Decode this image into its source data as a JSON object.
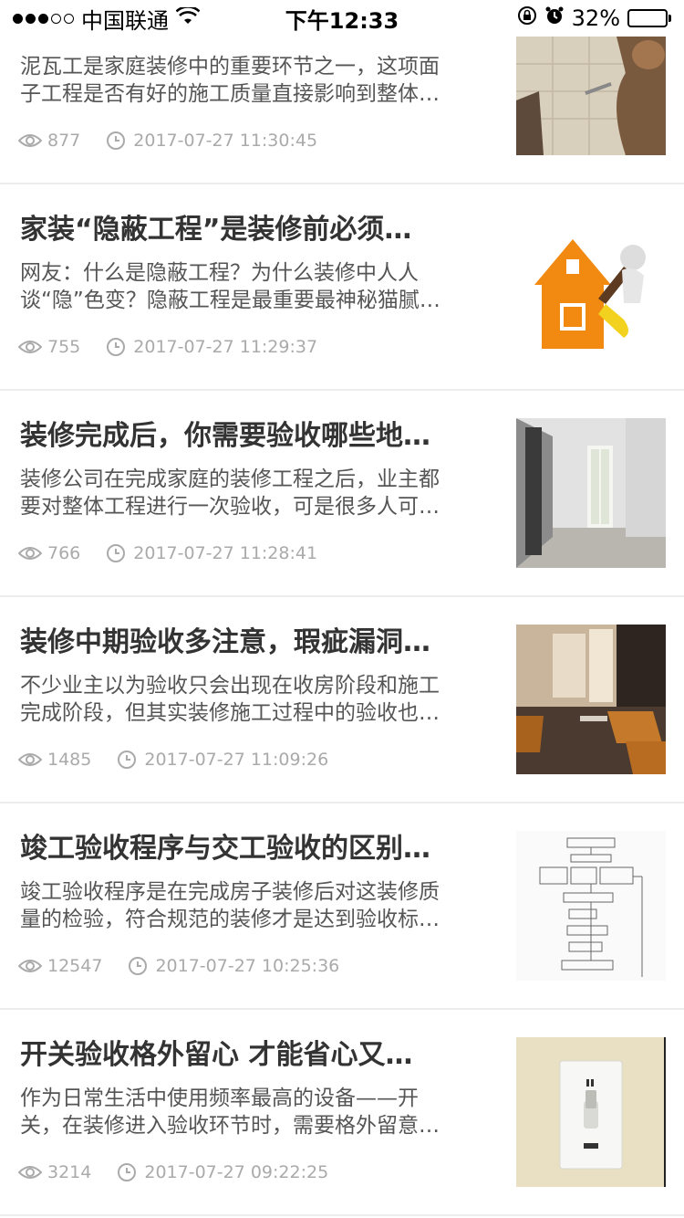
{
  "status_bar": {
    "carrier": "中国联通",
    "time": "下午12:33",
    "battery_percent": "32%",
    "battery_level": 0.32
  },
  "articles": [
    {
      "excerpt": "泥瓦工是家庭装修中的重要环节之一，这项面子工程是否有好的施工质量直接影响到整体…",
      "views": "877",
      "time": "2017-07-27 11:30:45",
      "image": "tiling-worker-photo"
    },
    {
      "title": "家装“隐蔽工程”是装修前必须…",
      "excerpt": "网友：什么是隐蔽工程？为什么装修中人人谈“隐”色变？隐蔽工程是最重要最神秘猫腻…",
      "views": "755",
      "time": "2017-07-27 11:29:37",
      "image": "orange-house-paintbrush-illustration"
    },
    {
      "title": "装修完成后，你需要验收哪些地…",
      "excerpt": "装修公司在完成家庭的装修工程之后，业主都要对整体工程进行一次验收，可是很多人可…",
      "views": "766",
      "time": "2017-07-27 11:28:41",
      "image": "empty-room-photo"
    },
    {
      "title": "装修中期验收多注意，瑕疵漏洞…",
      "excerpt": "不少业主以为验收只会出现在收房阶段和施工完成阶段，但其实装修施工过程中的验收也…",
      "views": "1485",
      "time": "2017-07-27 11:09:26",
      "image": "living-room-photo"
    },
    {
      "title": "竣工验收程序与交工验收的区别…",
      "excerpt": "竣工验收程序是在完成房子装修后对这装修质量的检验，符合规范的装修才是达到验收标…",
      "views": "12547",
      "time": "2017-07-27 10:25:36",
      "image": "flowchart-document"
    },
    {
      "title": "开关验收格外留心 才能省心又…",
      "excerpt": "作为日常生活中使用频率最高的设备——开关，在装修进入验收环节时，需要格外留意…",
      "views": "3214",
      "time": "2017-07-27 09:22:25",
      "image": "light-switch-photo"
    }
  ]
}
